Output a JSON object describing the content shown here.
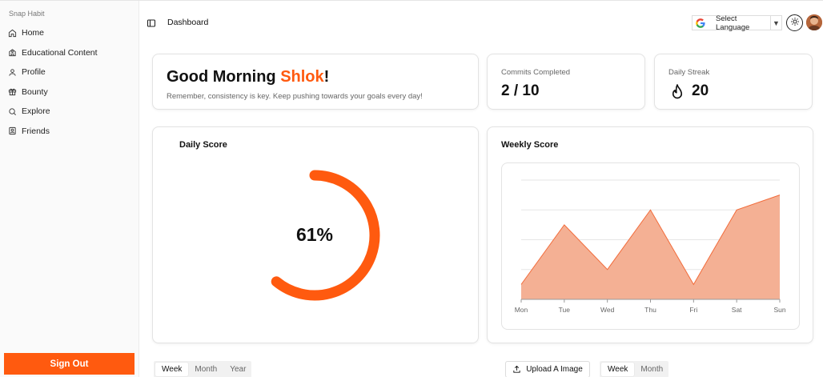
{
  "sidebar": {
    "app_name": "Snap Habit",
    "items": [
      {
        "label": "Home",
        "icon": "home-icon"
      },
      {
        "label": "Educational Content",
        "icon": "school-icon"
      },
      {
        "label": "Profile",
        "icon": "user-icon"
      },
      {
        "label": "Bounty",
        "icon": "gift-icon"
      },
      {
        "label": "Explore",
        "icon": "search-icon"
      },
      {
        "label": "Friends",
        "icon": "contact-icon"
      }
    ],
    "sign_out": "Sign Out"
  },
  "header": {
    "title": "Dashboard",
    "language": "Select Language"
  },
  "greeting": {
    "prefix": "Good Morning ",
    "name": "Shlok",
    "suffix": "!",
    "subtitle": "Remember, consistency is key. Keep pushing towards your goals every day!"
  },
  "stats": {
    "commits_label": "Commits Completed",
    "commits_value": "2 / 10",
    "streak_label": "Daily Streak",
    "streak_value": "20"
  },
  "daily": {
    "title": "Daily Score",
    "percent_text": "61%",
    "percent": 61
  },
  "weekly": {
    "title": "Weekly Score"
  },
  "chart_data": {
    "type": "area",
    "categories": [
      "Mon",
      "Tue",
      "Wed",
      "Thu",
      "Fri",
      "Sat",
      "Sun"
    ],
    "values": [
      1,
      5,
      2,
      6,
      1,
      6,
      7
    ],
    "ylim": [
      0,
      8
    ],
    "grid": true,
    "color": "#f4b094",
    "line_color": "#f26b3a"
  },
  "controls": {
    "range_left": [
      "Week",
      "Month",
      "Year"
    ],
    "range_right": [
      "Week",
      "Month"
    ],
    "upload": "Upload A Image"
  },
  "colors": {
    "accent": "#ff5a0f"
  }
}
